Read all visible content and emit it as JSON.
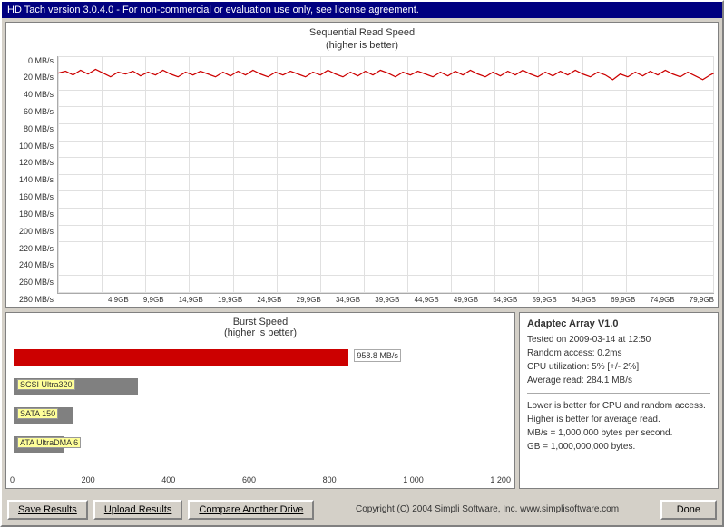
{
  "title_bar": {
    "text": "HD Tach version 3.0.4.0  - For non-commercial or evaluation use only, see license agreement."
  },
  "seq_chart": {
    "title_line1": "Sequential Read Speed",
    "title_line2": "(higher is better)",
    "y_labels": [
      "0 MB/s",
      "20 MB/s",
      "40 MB/s",
      "60 MB/s",
      "80 MB/s",
      "100 MB/s",
      "120 MB/s",
      "140 MB/s",
      "160 MB/s",
      "180 MB/s",
      "200 MB/s",
      "220 MB/s",
      "240 MB/s",
      "260 MB/s",
      "280 MB/s"
    ],
    "x_labels": [
      "4,9GB",
      "9,9GB",
      "14,9GB",
      "19,9GB",
      "24,9GB",
      "29,9GB",
      "34,9GB",
      "39,9GB",
      "44,9GB",
      "49,9GB",
      "54,9GB",
      "59,9GB",
      "64,9GB",
      "69,9GB",
      "74,9GB",
      "79,9GB"
    ]
  },
  "burst_chart": {
    "title_line1": "Burst Speed",
    "title_line2": "(higher is better)",
    "bars": [
      {
        "label": "",
        "value": "958.8 MB/s",
        "width_pct": 77,
        "color": "#cc0000"
      },
      {
        "label": "SCSI Ultra320",
        "value": "",
        "width_pct": 27,
        "color": "#808080"
      },
      {
        "label": "SATA 150",
        "value": "",
        "width_pct": 13,
        "color": "#808080"
      },
      {
        "label": "ATA UltraDMA 6",
        "value": "",
        "width_pct": 11,
        "color": "#808080"
      }
    ],
    "x_labels": [
      "0",
      "200",
      "400",
      "600",
      "800",
      "1 000",
      "1 200"
    ]
  },
  "info_panel": {
    "title": "Adaptec Array V1.0",
    "lines": [
      "Tested on 2009-03-14 at 12:50",
      "Random access: 0.2ms",
      "CPU utilization: 5% [+/- 2%]",
      "Average read: 284.1 MB/s"
    ],
    "notes": [
      "Lower is better for CPU and random access.",
      "Higher is better for average read.",
      "MB/s = 1,000,000 bytes per second.",
      "GB = 1,000,000,000 bytes."
    ]
  },
  "toolbar": {
    "save_label": "Save Results",
    "upload_label": "Upload Results",
    "compare_label": "Compare Another Drive",
    "copyright": "Copyright (C) 2004 Simpli Software, Inc. www.simplisoftware.com",
    "done_label": "Done"
  }
}
